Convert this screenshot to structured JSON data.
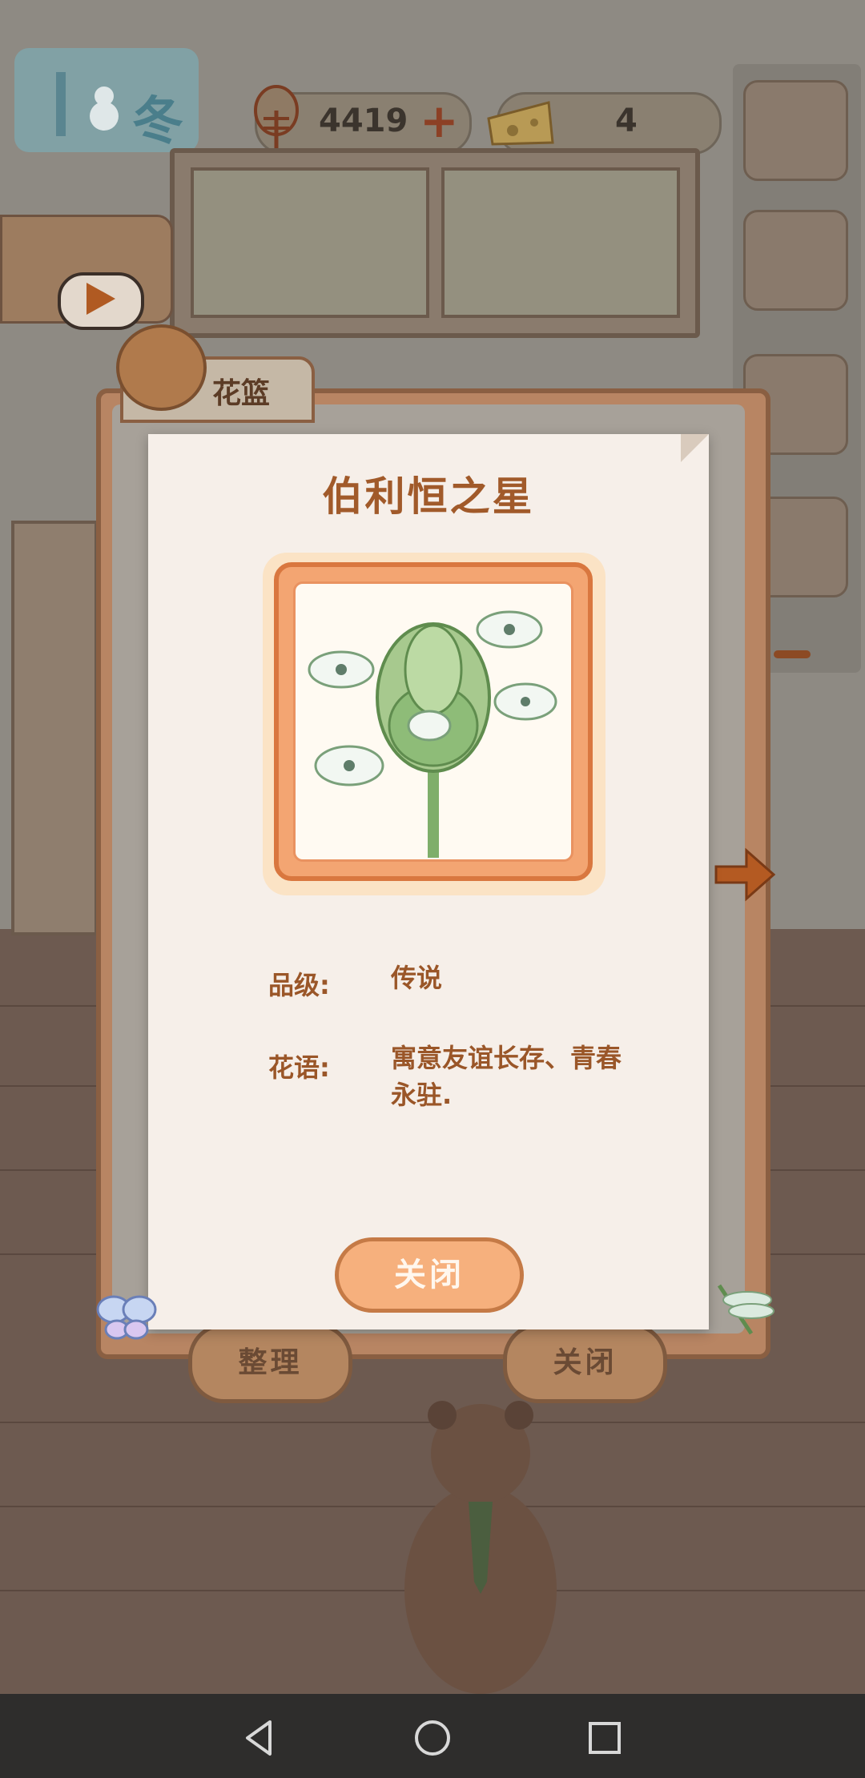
{
  "hud": {
    "season": "冬",
    "fish_count": "4419",
    "cheese_count": "4"
  },
  "dialog": {
    "tab_label": "花篮",
    "bottom_left_button": "整理",
    "bottom_right_button": "关闭"
  },
  "card": {
    "title": "伯利恒之星",
    "grade_label": "品级:",
    "grade_value": "传说",
    "meaning_label": "花语:",
    "meaning_value": "寓意友谊长存、青春永驻.",
    "close_button": "关闭"
  },
  "colors": {
    "accent": "#a15a2a",
    "button": "#f6b07d",
    "paper": "#f6efe9"
  },
  "icons": {
    "fish": "fish-icon",
    "cheese": "cheese-icon",
    "next": "arrow-right-icon",
    "nav_back": "back-icon",
    "nav_home": "home-icon",
    "nav_recent": "recent-apps-icon"
  }
}
